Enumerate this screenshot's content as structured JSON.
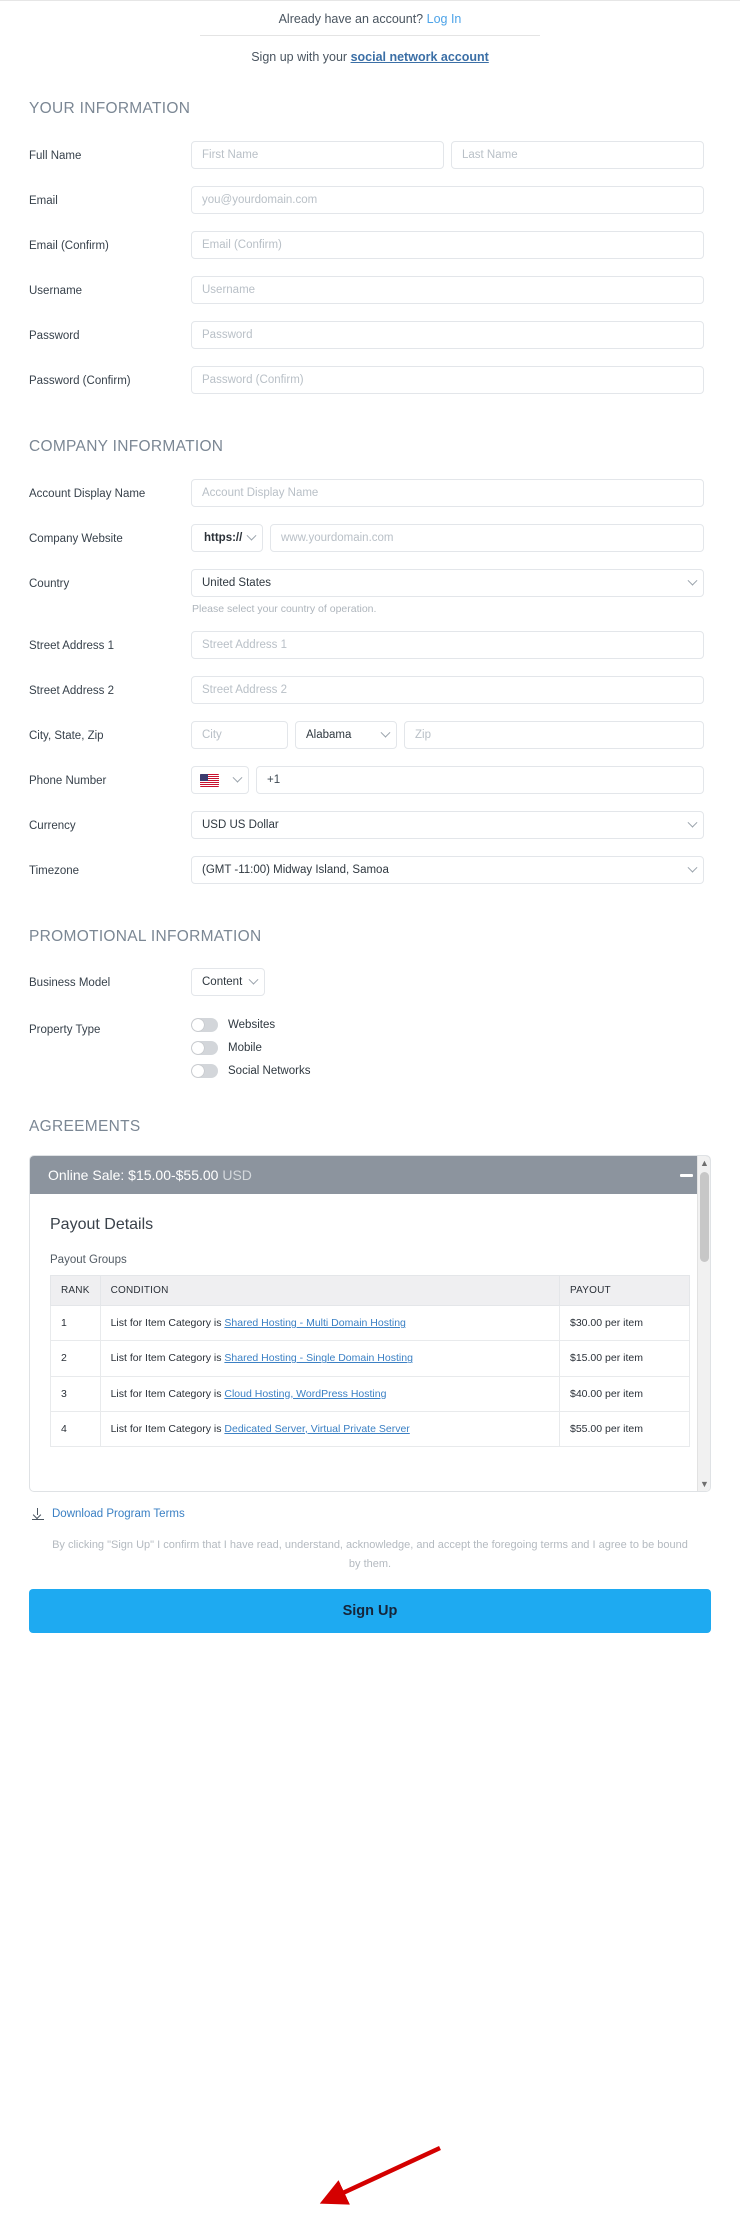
{
  "header": {
    "account_prompt": "Already have an account?",
    "login_link": "Log In",
    "social_prefix": "Sign up with your ",
    "social_link": "social network account"
  },
  "sections": {
    "your_information": "YOUR INFORMATION",
    "company_information": "COMPANY INFORMATION",
    "promotional_information": "PROMOTIONAL INFORMATION",
    "agreements": "AGREEMENTS"
  },
  "your_information": {
    "full_name_label": "Full Name",
    "first_name_placeholder": "First Name",
    "last_name_placeholder": "Last Name",
    "email_label": "Email",
    "email_placeholder": "you@yourdomain.com",
    "email_confirm_label": "Email (Confirm)",
    "email_confirm_placeholder": "Email (Confirm)",
    "username_label": "Username",
    "username_placeholder": "Username",
    "password_label": "Password",
    "password_placeholder": "Password",
    "password_confirm_label": "Password (Confirm)",
    "password_confirm_placeholder": "Password (Confirm)"
  },
  "company_information": {
    "account_display_name_label": "Account Display Name",
    "account_display_name_placeholder": "Account Display Name",
    "company_website_label": "Company Website",
    "protocol_value": "https://",
    "website_placeholder": "www.yourdomain.com",
    "country_label": "Country",
    "country_value": "United States",
    "country_hint": "Please select your country of operation.",
    "street1_label": "Street Address 1",
    "street1_placeholder": "Street Address 1",
    "street2_label": "Street Address 2",
    "street2_placeholder": "Street Address 2",
    "city_state_zip_label": "City, State, Zip",
    "city_placeholder": "City",
    "state_value": "Alabama",
    "zip_placeholder": "Zip",
    "phone_label": "Phone Number",
    "phone_value": "+1",
    "currency_label": "Currency",
    "currency_value": "USD US Dollar",
    "timezone_label": "Timezone",
    "timezone_value": "(GMT -11:00) Midway Island, Samoa"
  },
  "promotional_information": {
    "business_model_label": "Business Model",
    "business_model_value": "Content",
    "property_type_label": "Property Type",
    "property_types": [
      {
        "label": "Websites",
        "on": false
      },
      {
        "label": "Mobile",
        "on": false
      },
      {
        "label": "Social Networks",
        "on": false
      }
    ]
  },
  "agreements": {
    "panel_title": "Online Sale: $15.00-$55.00",
    "panel_currency": "USD",
    "payout_details_title": "Payout Details",
    "payout_groups_label": "Payout Groups",
    "table": {
      "columns": [
        "RANK",
        "CONDITION",
        "PAYOUT"
      ],
      "rows": [
        {
          "rank": "1",
          "condition_prefix": "List for Item Category is ",
          "condition_link": "Shared Hosting - Multi Domain Hosting",
          "payout": "$30.00 per item"
        },
        {
          "rank": "2",
          "condition_prefix": "List for Item Category is ",
          "condition_link": "Shared Hosting - Single Domain Hosting",
          "payout": "$15.00 per item"
        },
        {
          "rank": "3",
          "condition_prefix": "List for Item Category is ",
          "condition_link": "Cloud Hosting, WordPress Hosting",
          "payout": "$40.00 per item"
        },
        {
          "rank": "4",
          "condition_prefix": "List for Item Category is ",
          "condition_link": "Dedicated Server, Virtual Private Server",
          "payout": "$55.00 per item"
        }
      ]
    },
    "download_link": "Download Program Terms"
  },
  "footer": {
    "terms_text": "By clicking \"Sign Up\" I confirm that I have read, understand, acknowledge, and accept the foregoing terms and I agree to be bound by them.",
    "signup_label": "Sign Up"
  },
  "colors": {
    "accent": "#1eaaf1",
    "link": "#3b80c4",
    "panel_header": "#8c949e",
    "annotation": "#d40000"
  }
}
